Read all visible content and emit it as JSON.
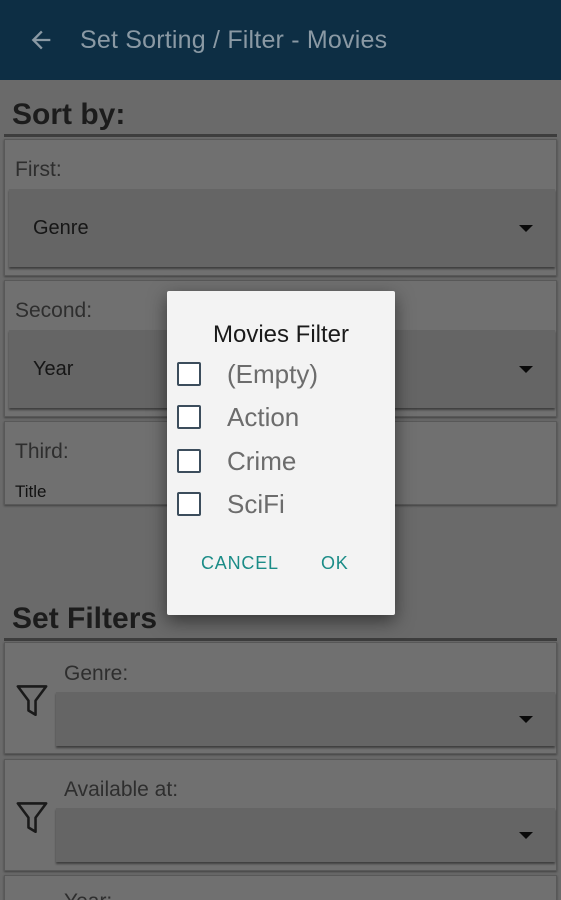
{
  "app_bar": {
    "title": "Set Sorting / Filter - Movies",
    "back_icon": "arrow-left-icon"
  },
  "sort_section": {
    "title": "Sort by:",
    "first": {
      "label": "First:",
      "value": "Genre"
    },
    "second": {
      "label": "Second:",
      "value": "Year"
    },
    "third": {
      "label": "Third:",
      "value": "Title"
    }
  },
  "filter_section": {
    "title": "Set Filters",
    "filters": [
      {
        "label": "Genre:",
        "value": "",
        "icon": "filter-icon"
      },
      {
        "label": "Available at:",
        "value": "",
        "icon": "filter-icon"
      },
      {
        "label": "Year:",
        "value": "",
        "icon": "filter-icon"
      }
    ]
  },
  "dialog": {
    "title": "Movies Filter",
    "options": [
      {
        "label": "(Empty)",
        "checked": false
      },
      {
        "label": "Action",
        "checked": false
      },
      {
        "label": "Crime",
        "checked": false
      },
      {
        "label": "SciFi",
        "checked": false
      }
    ],
    "cancel_label": "CANCEL",
    "ok_label": "OK"
  },
  "colors": {
    "app_bar": "#0d2e44",
    "accent": "#1b8c87",
    "scrim_background": "#6a6a6a"
  }
}
